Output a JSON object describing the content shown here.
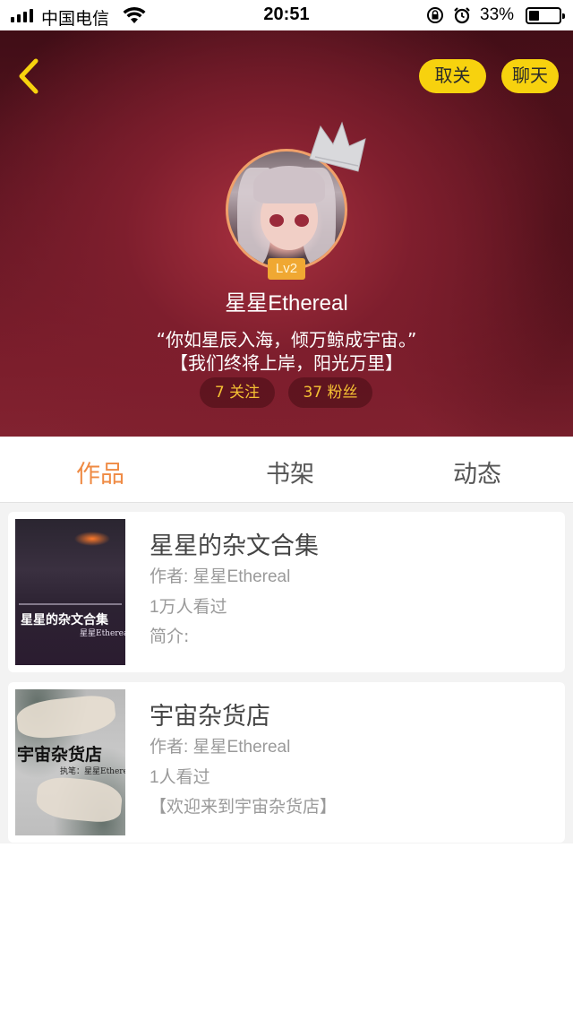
{
  "status_bar": {
    "carrier": "中国电信",
    "time": "20:51",
    "battery_percent": "33%",
    "battery_level": 0.33,
    "icons": [
      "signal-icon",
      "wifi-icon",
      "rotation-lock-icon",
      "alarm-icon",
      "battery-icon"
    ]
  },
  "header": {
    "back_icon": "chevron-left-icon",
    "unfollow_label": "取关",
    "chat_label": "聊天"
  },
  "profile": {
    "level": "Lv2",
    "username": "星星Ethereal",
    "bio_line1": "“你如星辰入海，倾万鲸成宇宙。”",
    "bio_line2": "【我们终将上岸，阳光万里】",
    "following": "7 关注",
    "followers": "37 粉丝"
  },
  "tabs": {
    "active": "作品",
    "items": [
      "作品",
      "书架",
      "动态"
    ]
  },
  "books": [
    {
      "title": "星星的杂文合集",
      "author": "作者: 星星Ethereal",
      "views": "1万人看过",
      "intro": "简介:",
      "cover_title": "星星的杂文合集",
      "cover_author": "星星Ethereal"
    },
    {
      "title": "宇宙杂货店",
      "author": "作者: 星星Ethereal",
      "views": "1人看过",
      "intro": "【欢迎来到宇宙杂货店】",
      "cover_title": "宇宙杂货店",
      "cover_author": "执笔：星星Ethereal"
    }
  ],
  "colors": {
    "accent": "#ef8a43",
    "button_yellow": "#f7d20e",
    "stat_text": "#f5c033",
    "level_badge": "#f0a832"
  }
}
